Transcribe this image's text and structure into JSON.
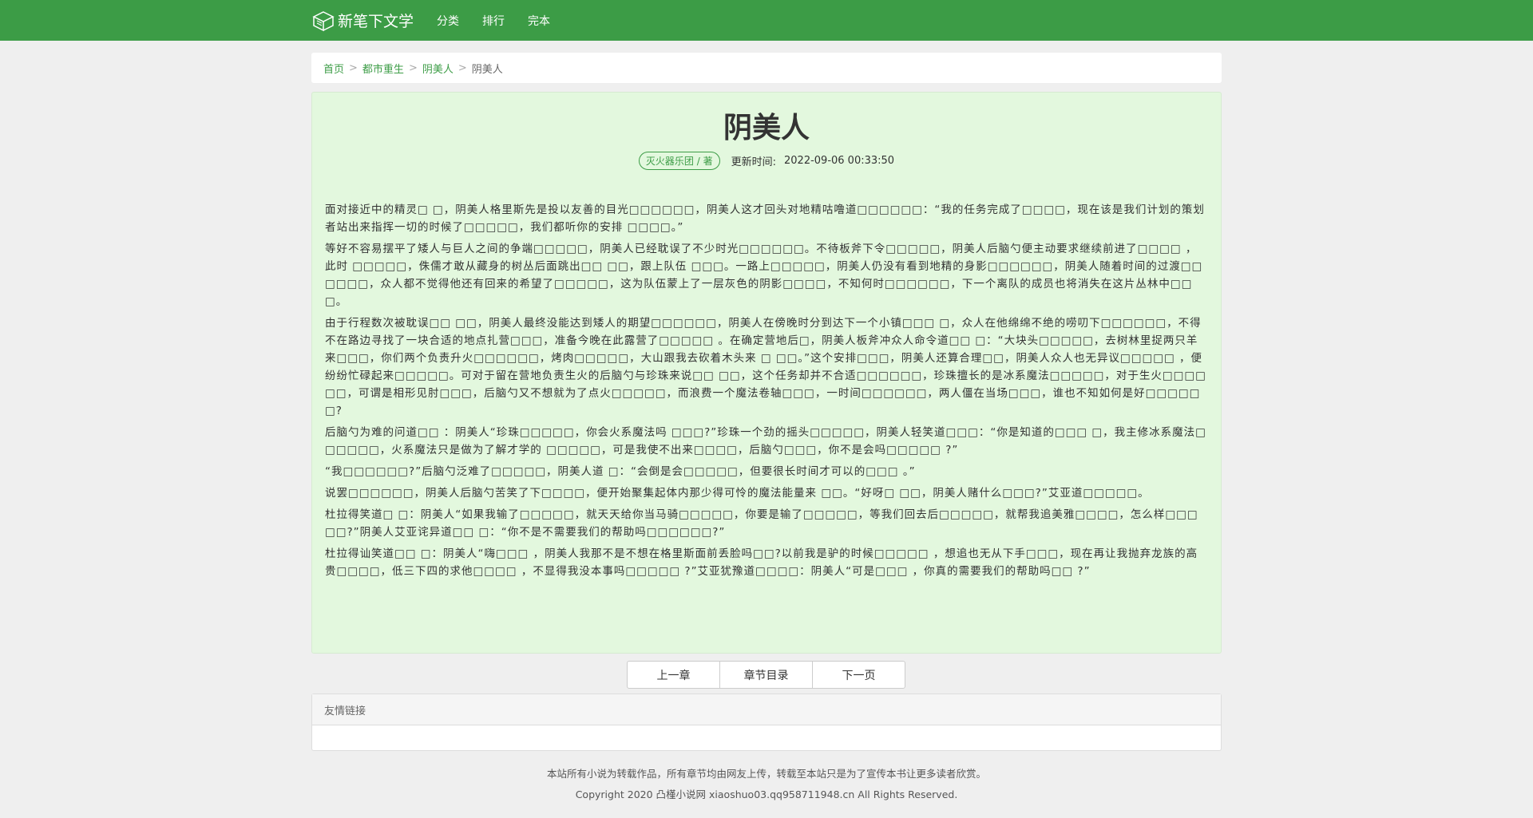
{
  "nav": {
    "logo_text": "新笔下文学",
    "links": [
      "分类",
      "排行",
      "完本"
    ]
  },
  "breadcrumb": {
    "items": [
      "首页",
      "都市重生",
      "阴美人"
    ],
    "current": "阴美人",
    "separator": ">"
  },
  "chapter": {
    "title": "阴美人",
    "author": "灭火器乐团 / 著",
    "update_label": "更新时间:",
    "update_time": "2022-09-06 00:33:50",
    "paragraphs": [
      "面对接近中的精灵□ □，阴美人格里斯先是投以友善的目光□□□□□□，阴美人这才回头对地精咕噜道□□□□□□：“我的任务完成了□□□□，现在该是我们计划的策划者站出来指挥一切的时候了□□□□□，我们都听你的安排 □□□□。”",
      "等好不容易摆平了矮人与巨人之间的争端□□□□□，阴美人已经耽误了不少时光□□□□□□。不待板斧下令□□□□□，阴美人后脑勺便主动要求继续前进了□□□□ ，此时 □□□□□，侏儒才敢从藏身的树丛后面跳出□□ □□，跟上队伍 □□□。一路上□□□□□，阴美人仍没有看到地精的身影□□□□□□，阴美人随着时间的过渡□□□□□□，众人都不觉得他还有回来的希望了□□□□□，这为队伍蒙上了一层灰色的阴影□□□□，不知何时□□□□□□，下一个离队的成员也将消失在这片丛林中□□ □。",
      "由于行程数次被耽误□□ □□，阴美人最终没能达到矮人的期望□□□□□□，阴美人在傍晚时分到达下一个小镇□□□ □，众人在他绵绵不绝的唠叨下□□□□□□，不得不在路边寻找了一块合适的地点扎营□□□，准备今晚在此露营了□□□□□ 。在确定营地后□，阴美人板斧冲众人命令道□□ □：“大块头□□□□□，去树林里捉两只羊来□□□，你们两个负责升火□□□□□□，烤肉□□□□□，大山跟我去砍着木头来 □ □□。”这个安排□□□，阴美人还算合理□□，阴美人众人也无异议□□□□□ ，便纷纷忙碌起来□□□□□。可对于留在营地负责生火的后脑勺与珍珠来说□□ □□，这个任务却并不合适□□□□□□，珍珠擅长的是冰系魔法□□□□□，对于生火□□□□□□，可谓是相形见肘□□□，后脑勺又不想就为了点火□□□□□，而浪费一个魔法卷轴□□□，一时间□□□□□□，两人僵在当场□□□，谁也不知如何是好□□□□□□?",
      "后脑勺为难的问道□□ ：阴美人“珍珠□□□□□，你会火系魔法吗 □□□?”珍珠一个劲的摇头□□□□□，阴美人轻笑道□□□：“你是知道的□□□ □，我主修冰系魔法□□□□□□，火系魔法只是做为了解才学的 □□□□□，可是我使不出来□□□□，后脑勺□□□，你不是会吗□□□□□ ?”",
      "“我□□□□□□?”后脑勺泛难了□□□□□，阴美人道 □：“会倒是会□□□□□，但要很长时间才可以的□□□ 。”",
      "说罢□□□□□□，阴美人后脑勺苦笑了下□□□□，便开始聚集起体内那少得可怜的魔法能量来 □□。“好呀□ □□，阴美人赌什么□□□?”艾亚道□□□□□。",
      "杜拉得笑道□ □：阴美人“如果我输了□□□□□，就天天给你当马骑□□□□□，你要是输了□□□□□，等我们回去后□□□□□，就帮我追美雅□□□□，怎么样□□□□□?”阴美人艾亚诧异道□□ □：“你不是不需要我们的帮助吗□□□□□□?”",
      "杜拉得讪笑道□□ □：阴美人“嗨□□□ ，阴美人我那不是不想在格里斯面前丢脸吗□□?以前我是驴的时候□□□□□ ，想追也无从下手□□□，现在再让我抛弃龙族的高贵□□□□，低三下四的求他□□□□ ，不显得我没本事吗□□□□□ ?”艾亚犹豫道□□□□：阴美人“可是□□□ ，你真的需要我们的帮助吗□□ ?”"
    ]
  },
  "pager": {
    "prev": "上一章",
    "toc": "章节目录",
    "next": "下一页"
  },
  "links_section": {
    "title": "友情链接"
  },
  "footer": {
    "line1": "本站所有小说为转载作品，所有章节均由网友上传，转载至本站只是为了宣传本书让更多读者欣赏。",
    "line2": "Copyright 2020 凸槿小说网 xiaoshuo03.qq958711948.cn All Rights Reserved."
  },
  "colors": {
    "nav_green": "#3c9c46",
    "content_bg": "#e3f8de",
    "page_bg": "#efefef"
  }
}
